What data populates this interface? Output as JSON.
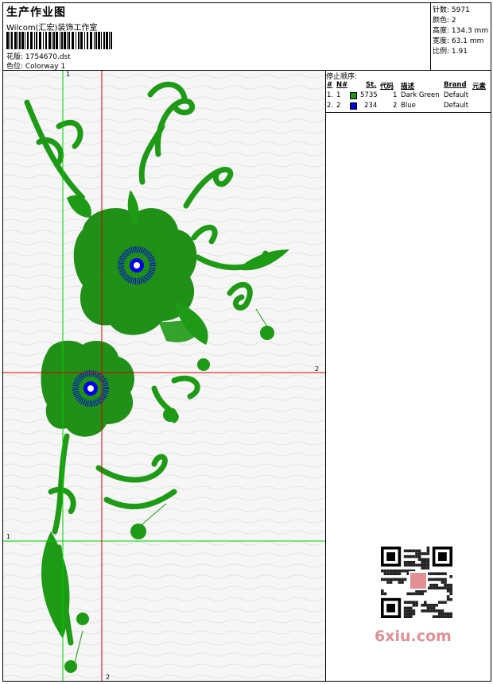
{
  "header": {
    "title": "生产作业图",
    "company": "Wilcom(汇宏)装饰工作室",
    "design_line": "花版: 1754670.dst",
    "colorway_line": "色位:  Colorway 1"
  },
  "stats": [
    {
      "label": "针数",
      "value": "5971"
    },
    {
      "label": "颜色",
      "value": "2"
    },
    {
      "label": "高度",
      "value": "134.3 mm"
    },
    {
      "label": "宽度",
      "value": "63.1 mm"
    },
    {
      "label": "比例",
      "value": "1.91"
    }
  ],
  "stop_sequence": {
    "title": "停止顺序:",
    "columns": {
      "idx": "#",
      "num": "N#",
      "st": "St.",
      "code": "代码",
      "desc": "描述",
      "brand": "Brand",
      "elem": "元素"
    },
    "rows": [
      {
        "idx": "1.",
        "num": "1",
        "color": "#1e9a16",
        "st": "5735",
        "code": "1",
        "desc": "Dark Green",
        "brand": "Default"
      },
      {
        "idx": "2.",
        "num": "2",
        "color": "#0000e6",
        "st": "234",
        "code": "2",
        "desc": "Blue",
        "brand": "Default"
      }
    ]
  },
  "axis_labels": {
    "h1": "1",
    "h2": "2",
    "v1": "1",
    "v2": "2"
  },
  "watermark": "6xiu.com",
  "colors": {
    "thread_green": "#1e9a16",
    "thread_blue": "#0000e6",
    "guide_green": "#00d000",
    "guide_red": "#e00000",
    "watermark_pink": "#e28f96"
  }
}
